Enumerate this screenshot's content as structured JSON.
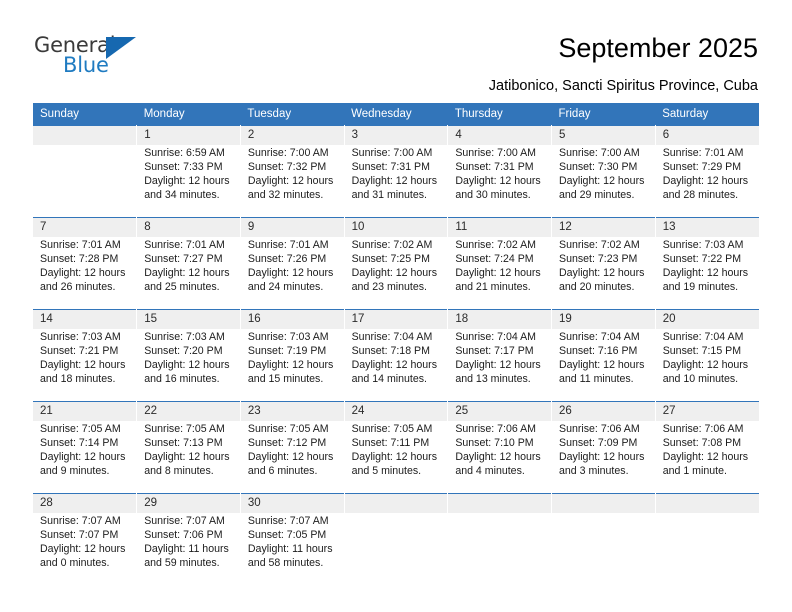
{
  "brand": {
    "name_top": "General",
    "name_bottom": "Blue",
    "accent_color": "#1f7bc1",
    "triangle_color": "#1668b0"
  },
  "header": {
    "title": "September 2025",
    "subtitle": "Jatibonico, Sancti Spiritus Province, Cuba"
  },
  "theme": {
    "header_bg": "#3275ba",
    "day_band_bg": "#efefef",
    "cell_bg": "#ffffff",
    "row_rule": "#3275ba"
  },
  "calendar": {
    "weekday_headers": [
      "Sunday",
      "Monday",
      "Tuesday",
      "Wednesday",
      "Thursday",
      "Friday",
      "Saturday"
    ],
    "weeks": [
      [
        {
          "day": "",
          "sunrise": "",
          "sunset": "",
          "daylight_1": "",
          "daylight_2": ""
        },
        {
          "day": "1",
          "sunrise": "Sunrise: 6:59 AM",
          "sunset": "Sunset: 7:33 PM",
          "daylight_1": "Daylight: 12 hours",
          "daylight_2": "and 34 minutes."
        },
        {
          "day": "2",
          "sunrise": "Sunrise: 7:00 AM",
          "sunset": "Sunset: 7:32 PM",
          "daylight_1": "Daylight: 12 hours",
          "daylight_2": "and 32 minutes."
        },
        {
          "day": "3",
          "sunrise": "Sunrise: 7:00 AM",
          "sunset": "Sunset: 7:31 PM",
          "daylight_1": "Daylight: 12 hours",
          "daylight_2": "and 31 minutes."
        },
        {
          "day": "4",
          "sunrise": "Sunrise: 7:00 AM",
          "sunset": "Sunset: 7:31 PM",
          "daylight_1": "Daylight: 12 hours",
          "daylight_2": "and 30 minutes."
        },
        {
          "day": "5",
          "sunrise": "Sunrise: 7:00 AM",
          "sunset": "Sunset: 7:30 PM",
          "daylight_1": "Daylight: 12 hours",
          "daylight_2": "and 29 minutes."
        },
        {
          "day": "6",
          "sunrise": "Sunrise: 7:01 AM",
          "sunset": "Sunset: 7:29 PM",
          "daylight_1": "Daylight: 12 hours",
          "daylight_2": "and 28 minutes."
        }
      ],
      [
        {
          "day": "7",
          "sunrise": "Sunrise: 7:01 AM",
          "sunset": "Sunset: 7:28 PM",
          "daylight_1": "Daylight: 12 hours",
          "daylight_2": "and 26 minutes."
        },
        {
          "day": "8",
          "sunrise": "Sunrise: 7:01 AM",
          "sunset": "Sunset: 7:27 PM",
          "daylight_1": "Daylight: 12 hours",
          "daylight_2": "and 25 minutes."
        },
        {
          "day": "9",
          "sunrise": "Sunrise: 7:01 AM",
          "sunset": "Sunset: 7:26 PM",
          "daylight_1": "Daylight: 12 hours",
          "daylight_2": "and 24 minutes."
        },
        {
          "day": "10",
          "sunrise": "Sunrise: 7:02 AM",
          "sunset": "Sunset: 7:25 PM",
          "daylight_1": "Daylight: 12 hours",
          "daylight_2": "and 23 minutes."
        },
        {
          "day": "11",
          "sunrise": "Sunrise: 7:02 AM",
          "sunset": "Sunset: 7:24 PM",
          "daylight_1": "Daylight: 12 hours",
          "daylight_2": "and 21 minutes."
        },
        {
          "day": "12",
          "sunrise": "Sunrise: 7:02 AM",
          "sunset": "Sunset: 7:23 PM",
          "daylight_1": "Daylight: 12 hours",
          "daylight_2": "and 20 minutes."
        },
        {
          "day": "13",
          "sunrise": "Sunrise: 7:03 AM",
          "sunset": "Sunset: 7:22 PM",
          "daylight_1": "Daylight: 12 hours",
          "daylight_2": "and 19 minutes."
        }
      ],
      [
        {
          "day": "14",
          "sunrise": "Sunrise: 7:03 AM",
          "sunset": "Sunset: 7:21 PM",
          "daylight_1": "Daylight: 12 hours",
          "daylight_2": "and 18 minutes."
        },
        {
          "day": "15",
          "sunrise": "Sunrise: 7:03 AM",
          "sunset": "Sunset: 7:20 PM",
          "daylight_1": "Daylight: 12 hours",
          "daylight_2": "and 16 minutes."
        },
        {
          "day": "16",
          "sunrise": "Sunrise: 7:03 AM",
          "sunset": "Sunset: 7:19 PM",
          "daylight_1": "Daylight: 12 hours",
          "daylight_2": "and 15 minutes."
        },
        {
          "day": "17",
          "sunrise": "Sunrise: 7:04 AM",
          "sunset": "Sunset: 7:18 PM",
          "daylight_1": "Daylight: 12 hours",
          "daylight_2": "and 14 minutes."
        },
        {
          "day": "18",
          "sunrise": "Sunrise: 7:04 AM",
          "sunset": "Sunset: 7:17 PM",
          "daylight_1": "Daylight: 12 hours",
          "daylight_2": "and 13 minutes."
        },
        {
          "day": "19",
          "sunrise": "Sunrise: 7:04 AM",
          "sunset": "Sunset: 7:16 PM",
          "daylight_1": "Daylight: 12 hours",
          "daylight_2": "and 11 minutes."
        },
        {
          "day": "20",
          "sunrise": "Sunrise: 7:04 AM",
          "sunset": "Sunset: 7:15 PM",
          "daylight_1": "Daylight: 12 hours",
          "daylight_2": "and 10 minutes."
        }
      ],
      [
        {
          "day": "21",
          "sunrise": "Sunrise: 7:05 AM",
          "sunset": "Sunset: 7:14 PM",
          "daylight_1": "Daylight: 12 hours",
          "daylight_2": "and 9 minutes."
        },
        {
          "day": "22",
          "sunrise": "Sunrise: 7:05 AM",
          "sunset": "Sunset: 7:13 PM",
          "daylight_1": "Daylight: 12 hours",
          "daylight_2": "and 8 minutes."
        },
        {
          "day": "23",
          "sunrise": "Sunrise: 7:05 AM",
          "sunset": "Sunset: 7:12 PM",
          "daylight_1": "Daylight: 12 hours",
          "daylight_2": "and 6 minutes."
        },
        {
          "day": "24",
          "sunrise": "Sunrise: 7:05 AM",
          "sunset": "Sunset: 7:11 PM",
          "daylight_1": "Daylight: 12 hours",
          "daylight_2": "and 5 minutes."
        },
        {
          "day": "25",
          "sunrise": "Sunrise: 7:06 AM",
          "sunset": "Sunset: 7:10 PM",
          "daylight_1": "Daylight: 12 hours",
          "daylight_2": "and 4 minutes."
        },
        {
          "day": "26",
          "sunrise": "Sunrise: 7:06 AM",
          "sunset": "Sunset: 7:09 PM",
          "daylight_1": "Daylight: 12 hours",
          "daylight_2": "and 3 minutes."
        },
        {
          "day": "27",
          "sunrise": "Sunrise: 7:06 AM",
          "sunset": "Sunset: 7:08 PM",
          "daylight_1": "Daylight: 12 hours",
          "daylight_2": "and 1 minute."
        }
      ],
      [
        {
          "day": "28",
          "sunrise": "Sunrise: 7:07 AM",
          "sunset": "Sunset: 7:07 PM",
          "daylight_1": "Daylight: 12 hours",
          "daylight_2": "and 0 minutes."
        },
        {
          "day": "29",
          "sunrise": "Sunrise: 7:07 AM",
          "sunset": "Sunset: 7:06 PM",
          "daylight_1": "Daylight: 11 hours",
          "daylight_2": "and 59 minutes."
        },
        {
          "day": "30",
          "sunrise": "Sunrise: 7:07 AM",
          "sunset": "Sunset: 7:05 PM",
          "daylight_1": "Daylight: 11 hours",
          "daylight_2": "and 58 minutes."
        },
        {
          "day": "",
          "sunrise": "",
          "sunset": "",
          "daylight_1": "",
          "daylight_2": ""
        },
        {
          "day": "",
          "sunrise": "",
          "sunset": "",
          "daylight_1": "",
          "daylight_2": ""
        },
        {
          "day": "",
          "sunrise": "",
          "sunset": "",
          "daylight_1": "",
          "daylight_2": ""
        },
        {
          "day": "",
          "sunrise": "",
          "sunset": "",
          "daylight_1": "",
          "daylight_2": ""
        }
      ]
    ]
  }
}
